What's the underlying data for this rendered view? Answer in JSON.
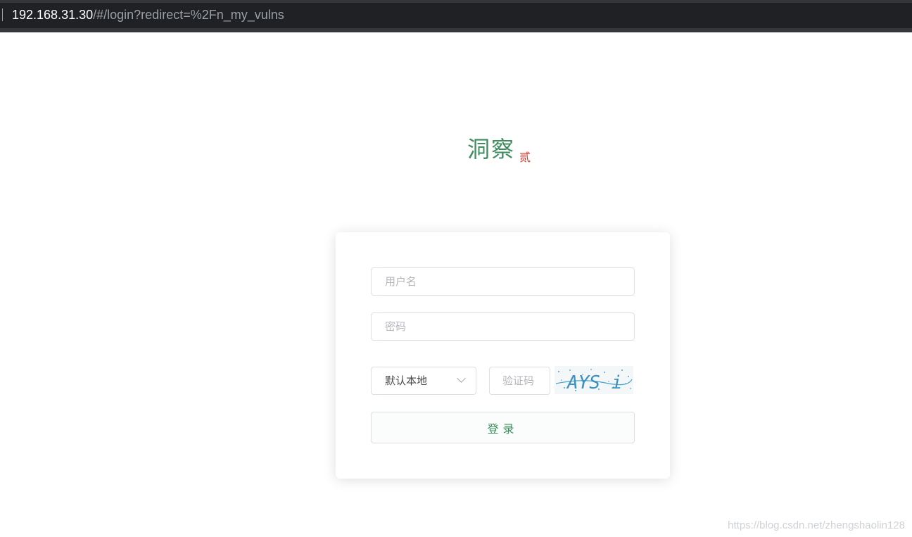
{
  "browser": {
    "address_host": "192.168.31.30",
    "address_path": "/#/login?redirect=%2Fn_my_vulns"
  },
  "logo": {
    "main": "洞察",
    "sub": "贰",
    "main_color": "#3e8c5f",
    "sub_color": "#d9372b"
  },
  "login": {
    "username_placeholder": "用户名",
    "password_placeholder": "密码",
    "select_value": "默认本地",
    "captcha_placeholder": "验证码",
    "captcha_text": "AYS i",
    "submit_label": "登录"
  },
  "watermark": "https://blog.csdn.net/zhengshaolin128"
}
